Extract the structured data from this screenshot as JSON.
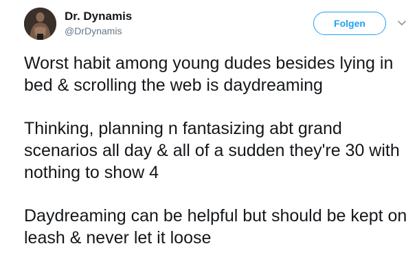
{
  "author": {
    "display_name": "Dr. Dynamis",
    "handle": "@DrDynamis"
  },
  "follow_button": {
    "label": "Folgen"
  },
  "tweet": {
    "paragraphs": [
      "Worst habit among young dudes besides lying in bed & scrolling the web is daydreaming",
      "Thinking, planning n fantasizing abt grand scenarios all day & all of a sudden they're 30 with nothing to show 4",
      "Daydreaming can be helpful but should be kept on leash & never let it loose"
    ]
  },
  "colors": {
    "accent": "#1da1f2",
    "text": "#14171a",
    "secondary_text": "#657786"
  },
  "icons": {
    "caret": "chevron-down-icon"
  }
}
